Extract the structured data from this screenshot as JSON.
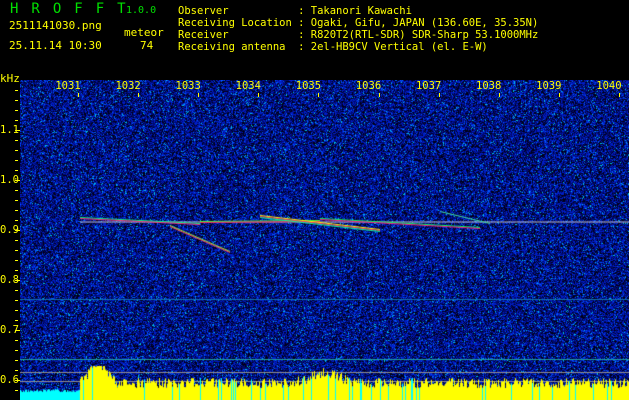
{
  "header": {
    "app_title": "HROFFT",
    "version": "1.0.0",
    "filename": "2511141030.png",
    "datetime": "25.11.14 10:30",
    "meteor_label": "meteor",
    "meteor_count": "74"
  },
  "info": [
    {
      "label": "Observer           ",
      "value": ": Takanori Kawachi"
    },
    {
      "label": "Receiving Location ",
      "value": ": Ogaki, Gifu, JAPAN (136.60E, 35.35N)"
    },
    {
      "label": "Receiver           ",
      "value": ": R820T2(RTL-SDR) SDR-Sharp 53.1000MHz"
    },
    {
      "label": "Receiving antenna  ",
      "value": ": 2el-HB9CV Vertical (el. E-W)"
    }
  ],
  "chart_data": {
    "type": "heatmap",
    "ylabel": "kHz",
    "x_tick_labels": [
      "1031",
      "1032",
      "1033",
      "1034",
      "1035",
      "1036",
      "1037",
      "1038",
      "1039",
      "1040"
    ],
    "y_tick_labels": [
      "1.1",
      "1.0",
      "0.9",
      "0.8",
      "0.7",
      "0.6"
    ],
    "y_ticks": [
      1.1,
      1.0,
      0.9,
      0.8,
      0.7,
      0.6
    ],
    "ylim": [
      0.56,
      1.2
    ],
    "carrier_khz": 0.917,
    "colors": {
      "background": "#000000",
      "noise": "#0020c0",
      "text": "#ffff00",
      "title": "#00e000",
      "histogram": "#ffff00",
      "histogram_low": "#00ffff"
    }
  }
}
